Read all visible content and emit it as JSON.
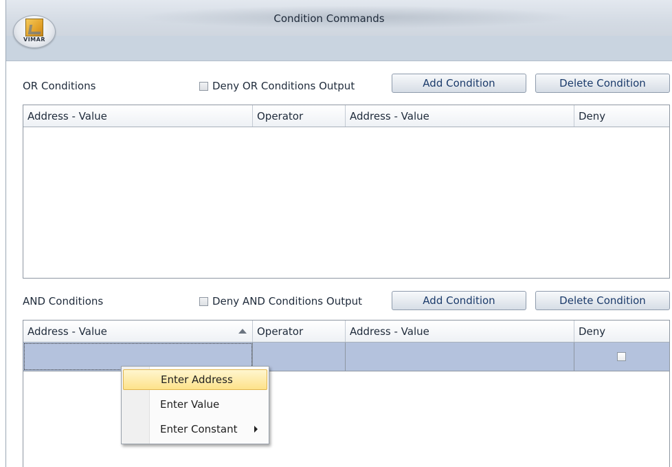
{
  "window": {
    "title": "Condition Commands",
    "brand": "VIMAR"
  },
  "or_section": {
    "label": "OR Conditions",
    "deny_label": "Deny OR Conditions Output",
    "deny_checked": false,
    "add_button": "Add Condition",
    "delete_button": "Delete Condition",
    "columns": [
      "Address - Value",
      "Operator",
      "Address - Value",
      "Deny"
    ],
    "rows": []
  },
  "and_section": {
    "label": "AND Conditions",
    "deny_label": "Deny AND Conditions Output",
    "deny_checked": false,
    "add_button": "Add Condition",
    "delete_button": "Delete Condition",
    "columns": [
      "Address - Value",
      "Operator",
      "Address - Value",
      "Deny"
    ],
    "rows": [
      {
        "address_value_1": "",
        "operator": "",
        "address_value_2": "",
        "deny": false
      }
    ]
  },
  "context_menu": {
    "items": [
      {
        "label": "Enter Address",
        "highlighted": true
      },
      {
        "label": "Enter Value",
        "highlighted": false
      },
      {
        "label": "Enter Constant",
        "has_submenu": true
      }
    ]
  },
  "colors": {
    "selected_row": "#b4c2dd",
    "menu_highlight": "#fde28a",
    "button_text": "#1a3a6a"
  }
}
